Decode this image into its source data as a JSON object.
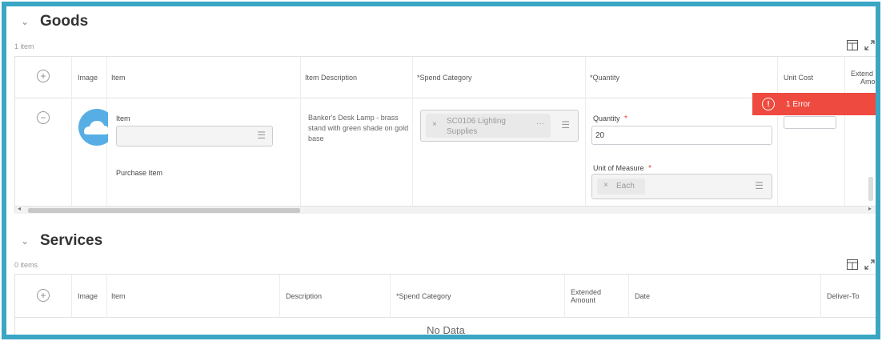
{
  "goods": {
    "title": "Goods",
    "count": "1 item",
    "columns": {
      "image": "Image",
      "item": "Item",
      "item_description": "Item Description",
      "spend_category": "*Spend Category",
      "quantity": "*Quantity",
      "unit_cost": "Unit Cost",
      "extended_line1": "Extend",
      "extended_line2": "Amou"
    },
    "row": {
      "item_label": "Item",
      "item_value": "",
      "purchase_item": "Purchase Item",
      "description": "Banker's Desk Lamp - brass stand with green shade on gold base",
      "spend_category_value": "SC0106 Lighting Supplies",
      "quantity_label": "Quantity",
      "quantity_value": "20",
      "uom_label": "Unit of Measure",
      "uom_value": "Each",
      "required_mark": "*"
    },
    "error": "1 Error"
  },
  "services": {
    "title": "Services",
    "count": "0 items",
    "columns": {
      "image": "Image",
      "item": "Item",
      "description": "Description",
      "spend_category": "*Spend Category",
      "extended_line1": "Extended",
      "extended_line2": "Amount",
      "date": "Date",
      "deliver_to": "Deliver-To"
    },
    "empty": "No Data"
  },
  "colors": {
    "frame_border": "#3aa6c4",
    "error": "#ef4a40",
    "required": "#e0403a"
  },
  "icons": {
    "collapse": "chevron-down-icon",
    "add": "plus-circle-icon",
    "remove": "minus-circle-icon",
    "list": "list-icon",
    "clear": "x-icon",
    "more": "ellipsis-icon",
    "columns": "column-view-icon",
    "expand": "expand-icon",
    "error": "alert-circle-icon"
  }
}
